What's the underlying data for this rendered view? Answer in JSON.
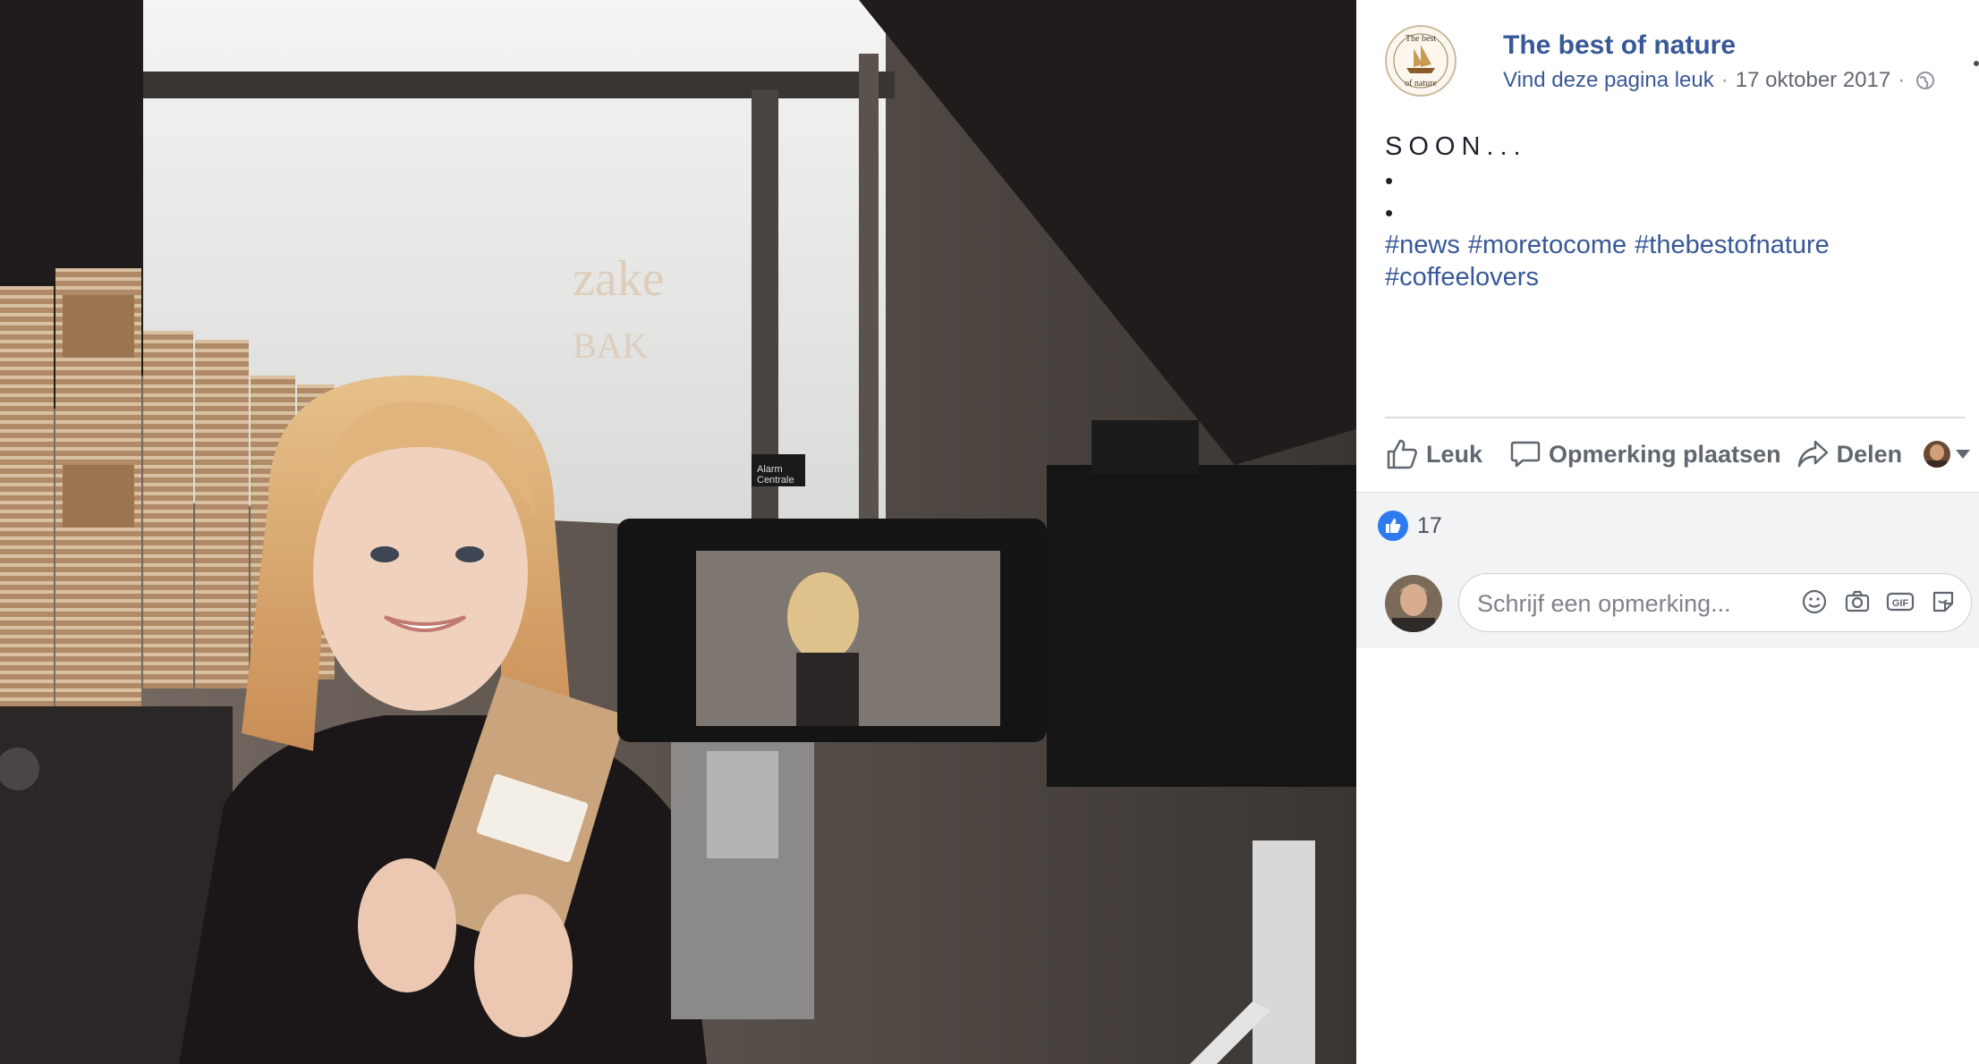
{
  "post": {
    "page_name": "The best of nature",
    "page_avatar_text_top": "The best",
    "page_avatar_text_bottom": "of nature",
    "like_page_link": "Vind deze pagina leuk",
    "separator": "·",
    "date": "17 oktober 2017",
    "visibility_icon": "globe-icon",
    "more_icon": "ellipsis-icon",
    "headline": "SOON...",
    "bullets": [
      "•",
      "•"
    ],
    "hashtags": [
      "#news",
      "#moretocome",
      "#thebestofnature",
      "#coffeelovers"
    ]
  },
  "photo": {
    "camera_screen_label": "Alarm Centrale",
    "alt": "Woman holding coffee bag in front of video camera"
  },
  "actions": {
    "like_label": "Leuk",
    "comment_label": "Opmerking plaatsen",
    "share_label": "Delen",
    "like_icon": "thumbs-up-icon",
    "comment_icon": "speech-bubble-icon",
    "share_icon": "share-arrow-icon"
  },
  "reactions": {
    "icon": "like-reaction-icon",
    "count": "17"
  },
  "comment": {
    "placeholder": "Schrijf een opmerking...",
    "tools": [
      "emoji-icon",
      "camera-icon",
      "gif-icon",
      "sticker-icon"
    ]
  },
  "colors": {
    "link": "#385898",
    "like_blue": "#2e7bf0",
    "text": "#1d2129",
    "muted": "#616770",
    "panel_gray": "#f2f3f5"
  }
}
